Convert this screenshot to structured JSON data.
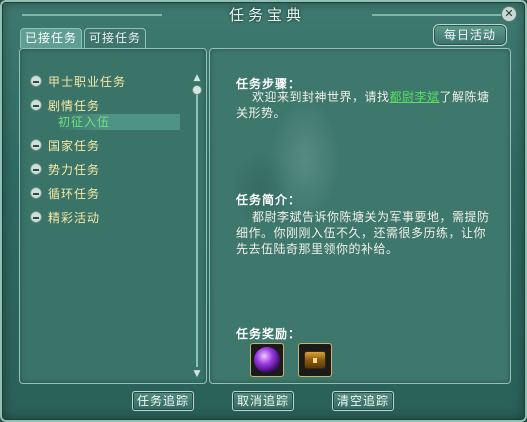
{
  "window": {
    "title": "任务宝典"
  },
  "tabs": [
    {
      "label": "已接任务",
      "active": true
    },
    {
      "label": "可接任务",
      "active": false
    }
  ],
  "daily_button": "每日活动",
  "quest_tree": {
    "categories": [
      {
        "label": "甲士职业任务"
      },
      {
        "label": "剧情任务",
        "children": [
          {
            "label": "初征入伍",
            "selected": true
          }
        ]
      },
      {
        "label": "国家任务"
      },
      {
        "label": "势力任务"
      },
      {
        "label": "循环任务"
      },
      {
        "label": "精彩活动"
      }
    ]
  },
  "detail": {
    "steps_title": "任务步骤：",
    "steps_text_before": "欢迎来到封神世界，请找",
    "steps_npc": "都尉李斌",
    "steps_text_after": "了解陈塘关形势。",
    "intro_title": "任务简介：",
    "intro_text": "都尉李斌告诉你陈塘关为军事要地，需提防细作。你刚刚入伍不久，还需很多历练，让你先去伍陆奇那里领你的补给。",
    "reward_title": "任务奖励：",
    "rewards": [
      {
        "icon": "purple-orb-icon"
      },
      {
        "icon": "treasure-chest-icon"
      }
    ]
  },
  "buttons": {
    "track": "任务追踪",
    "untrack": "取消追踪",
    "clear_track": "清空追踪"
  },
  "colors": {
    "panel": "#3e786d",
    "border": "#8fc2b5",
    "quest_category": "#f6e9a6",
    "quest_selected": "#6ee07a",
    "npc_link": "#56e05e"
  }
}
